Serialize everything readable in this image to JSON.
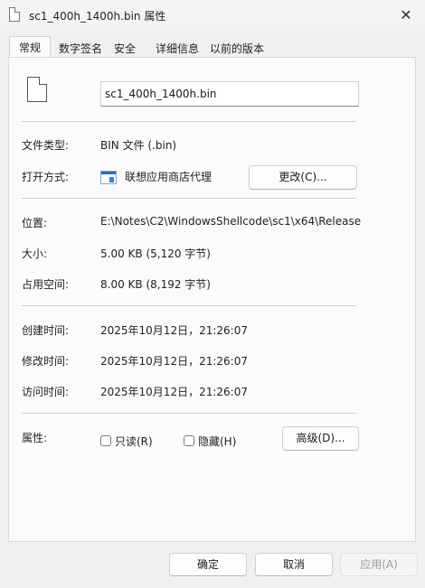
{
  "window": {
    "title": "sc1_400h_1400h.bin 属性",
    "close_glyph": "✕"
  },
  "tabs": [
    {
      "label": "常规",
      "active": true
    },
    {
      "label": "数字签名",
      "active": false
    },
    {
      "label": "安全",
      "active": false
    },
    {
      "label": "详细信息",
      "active": false
    },
    {
      "label": "以前的版本",
      "active": false
    }
  ],
  "general": {
    "file_name": "sc1_400h_1400h.bin",
    "file_type_label": "文件类型:",
    "file_type_value": "BIN 文件 (.bin)",
    "opens_with_label": "打开方式:",
    "opens_with_value": "联想应用商店代理",
    "change_button": "更改(C)...",
    "location_label": "位置:",
    "location_value": "E:\\Notes\\C2\\WindowsShellcode\\sc1\\x64\\Release",
    "size_label": "大小:",
    "size_value": "5.00 KB (5,120 字节)",
    "size_on_disk_label": "占用空间:",
    "size_on_disk_value": "8.00 KB (8,192 字节)",
    "created_label": "创建时间:",
    "created_value": "2025年10月12日，21:26:07",
    "modified_label": "修改时间:",
    "modified_value": "2025年10月12日，21:26:07",
    "accessed_label": "访问时间:",
    "accessed_value": "2025年10月12日，21:26:07",
    "attributes_label": "属性:",
    "readonly_label": "只读(R)",
    "hidden_label": "隐藏(H)",
    "advanced_button": "高级(D)..."
  },
  "footer": {
    "ok_button": "确定",
    "cancel_button": "取消",
    "apply_button": "应用(A)"
  }
}
